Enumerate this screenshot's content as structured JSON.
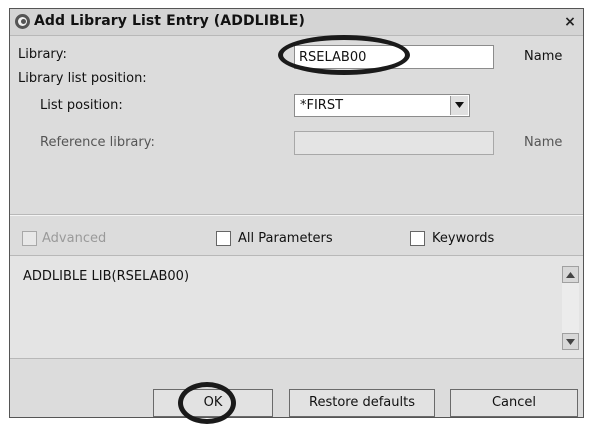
{
  "window": {
    "title": "Add Library List Entry (ADDLIBLE)",
    "close_glyph": "×",
    "title_icon": "eclipse-icon"
  },
  "form": {
    "library_label": "Library:",
    "library_value": "RSELAB00",
    "library_hint": "Name",
    "position_group_label": "Library list position:",
    "list_position_label": "List position:",
    "list_position_value": "*FIRST",
    "reference_label": "Reference library:",
    "reference_value": "",
    "reference_hint": "Name"
  },
  "options": {
    "advanced_label": "Advanced",
    "all_parameters_label": "All Parameters",
    "keywords_label": "Keywords"
  },
  "command": {
    "text": "ADDLIBLE LIB(RSELAB00)"
  },
  "buttons": {
    "ok": "OK",
    "restore": "Restore defaults",
    "cancel": "Cancel"
  }
}
